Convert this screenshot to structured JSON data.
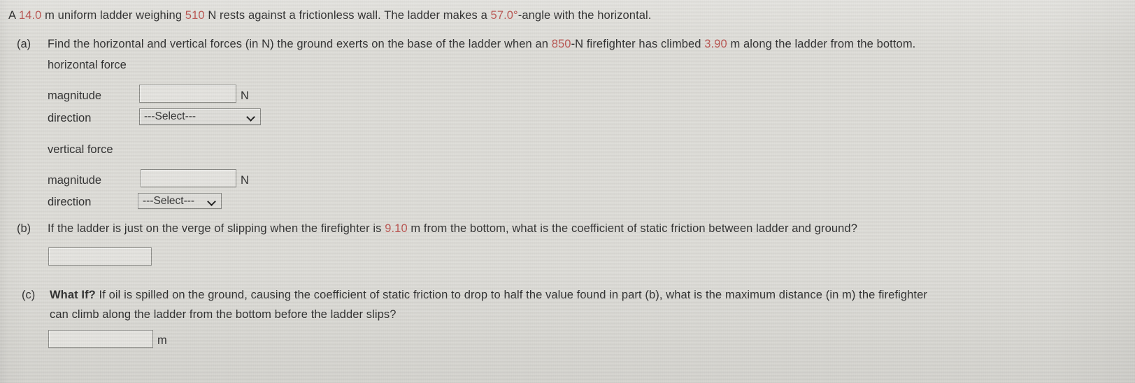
{
  "problem": {
    "stem": {
      "part1": "A ",
      "v_length": "14.0",
      "part2": " m uniform ladder weighing ",
      "v_weight": "510",
      "part3": " N rests against a frictionless wall. The ladder makes a ",
      "v_angle": "57.0°",
      "part4": "-angle with the horizontal."
    },
    "parts": [
      {
        "label": "(a)",
        "text_before": "Find the horizontal and vertical forces (in N) the ground exerts on the base of the ladder when an ",
        "v_force": "850",
        "text_mid": "-N firefighter has climbed ",
        "v_distance": "3.90",
        "text_after": " m along the ladder from the bottom."
      },
      {
        "label": "(b)",
        "text_before": "If the ladder is just on the verge of slipping when the firefighter is ",
        "v_distance": "9.10",
        "text_after": " m from the bottom, what is the coefficient of static friction between ladder and ground?"
      },
      {
        "label": "(c)",
        "bold_lead": "What If?",
        "text_line1": " If oil is spilled on the ground, causing the coefficient of static friction to drop to half the value found in part (b), what is the maximum distance (in m) the firefighter",
        "text_line2": "can climb along the ladder from the bottom before the ladder slips?"
      }
    ],
    "answer_blocks": {
      "horizontal_force": {
        "heading": "horizontal force",
        "magnitude_label": "magnitude",
        "magnitude_value": "",
        "magnitude_unit": "N",
        "direction_label": "direction",
        "direction_value": "---Select---"
      },
      "vertical_force": {
        "heading": "vertical force",
        "magnitude_label": "magnitude",
        "magnitude_value": "",
        "magnitude_unit": "N",
        "direction_label": "direction",
        "direction_value": "---Select---"
      },
      "part_b": {
        "value": ""
      },
      "part_c": {
        "value": "",
        "unit": "m"
      }
    },
    "colors": {
      "page_background": "#dcdbd6",
      "text": "#2b2b2b",
      "highlight_number": "#b9534f",
      "field_border": "#8a8a86",
      "field_background": "#e3e2de"
    }
  }
}
